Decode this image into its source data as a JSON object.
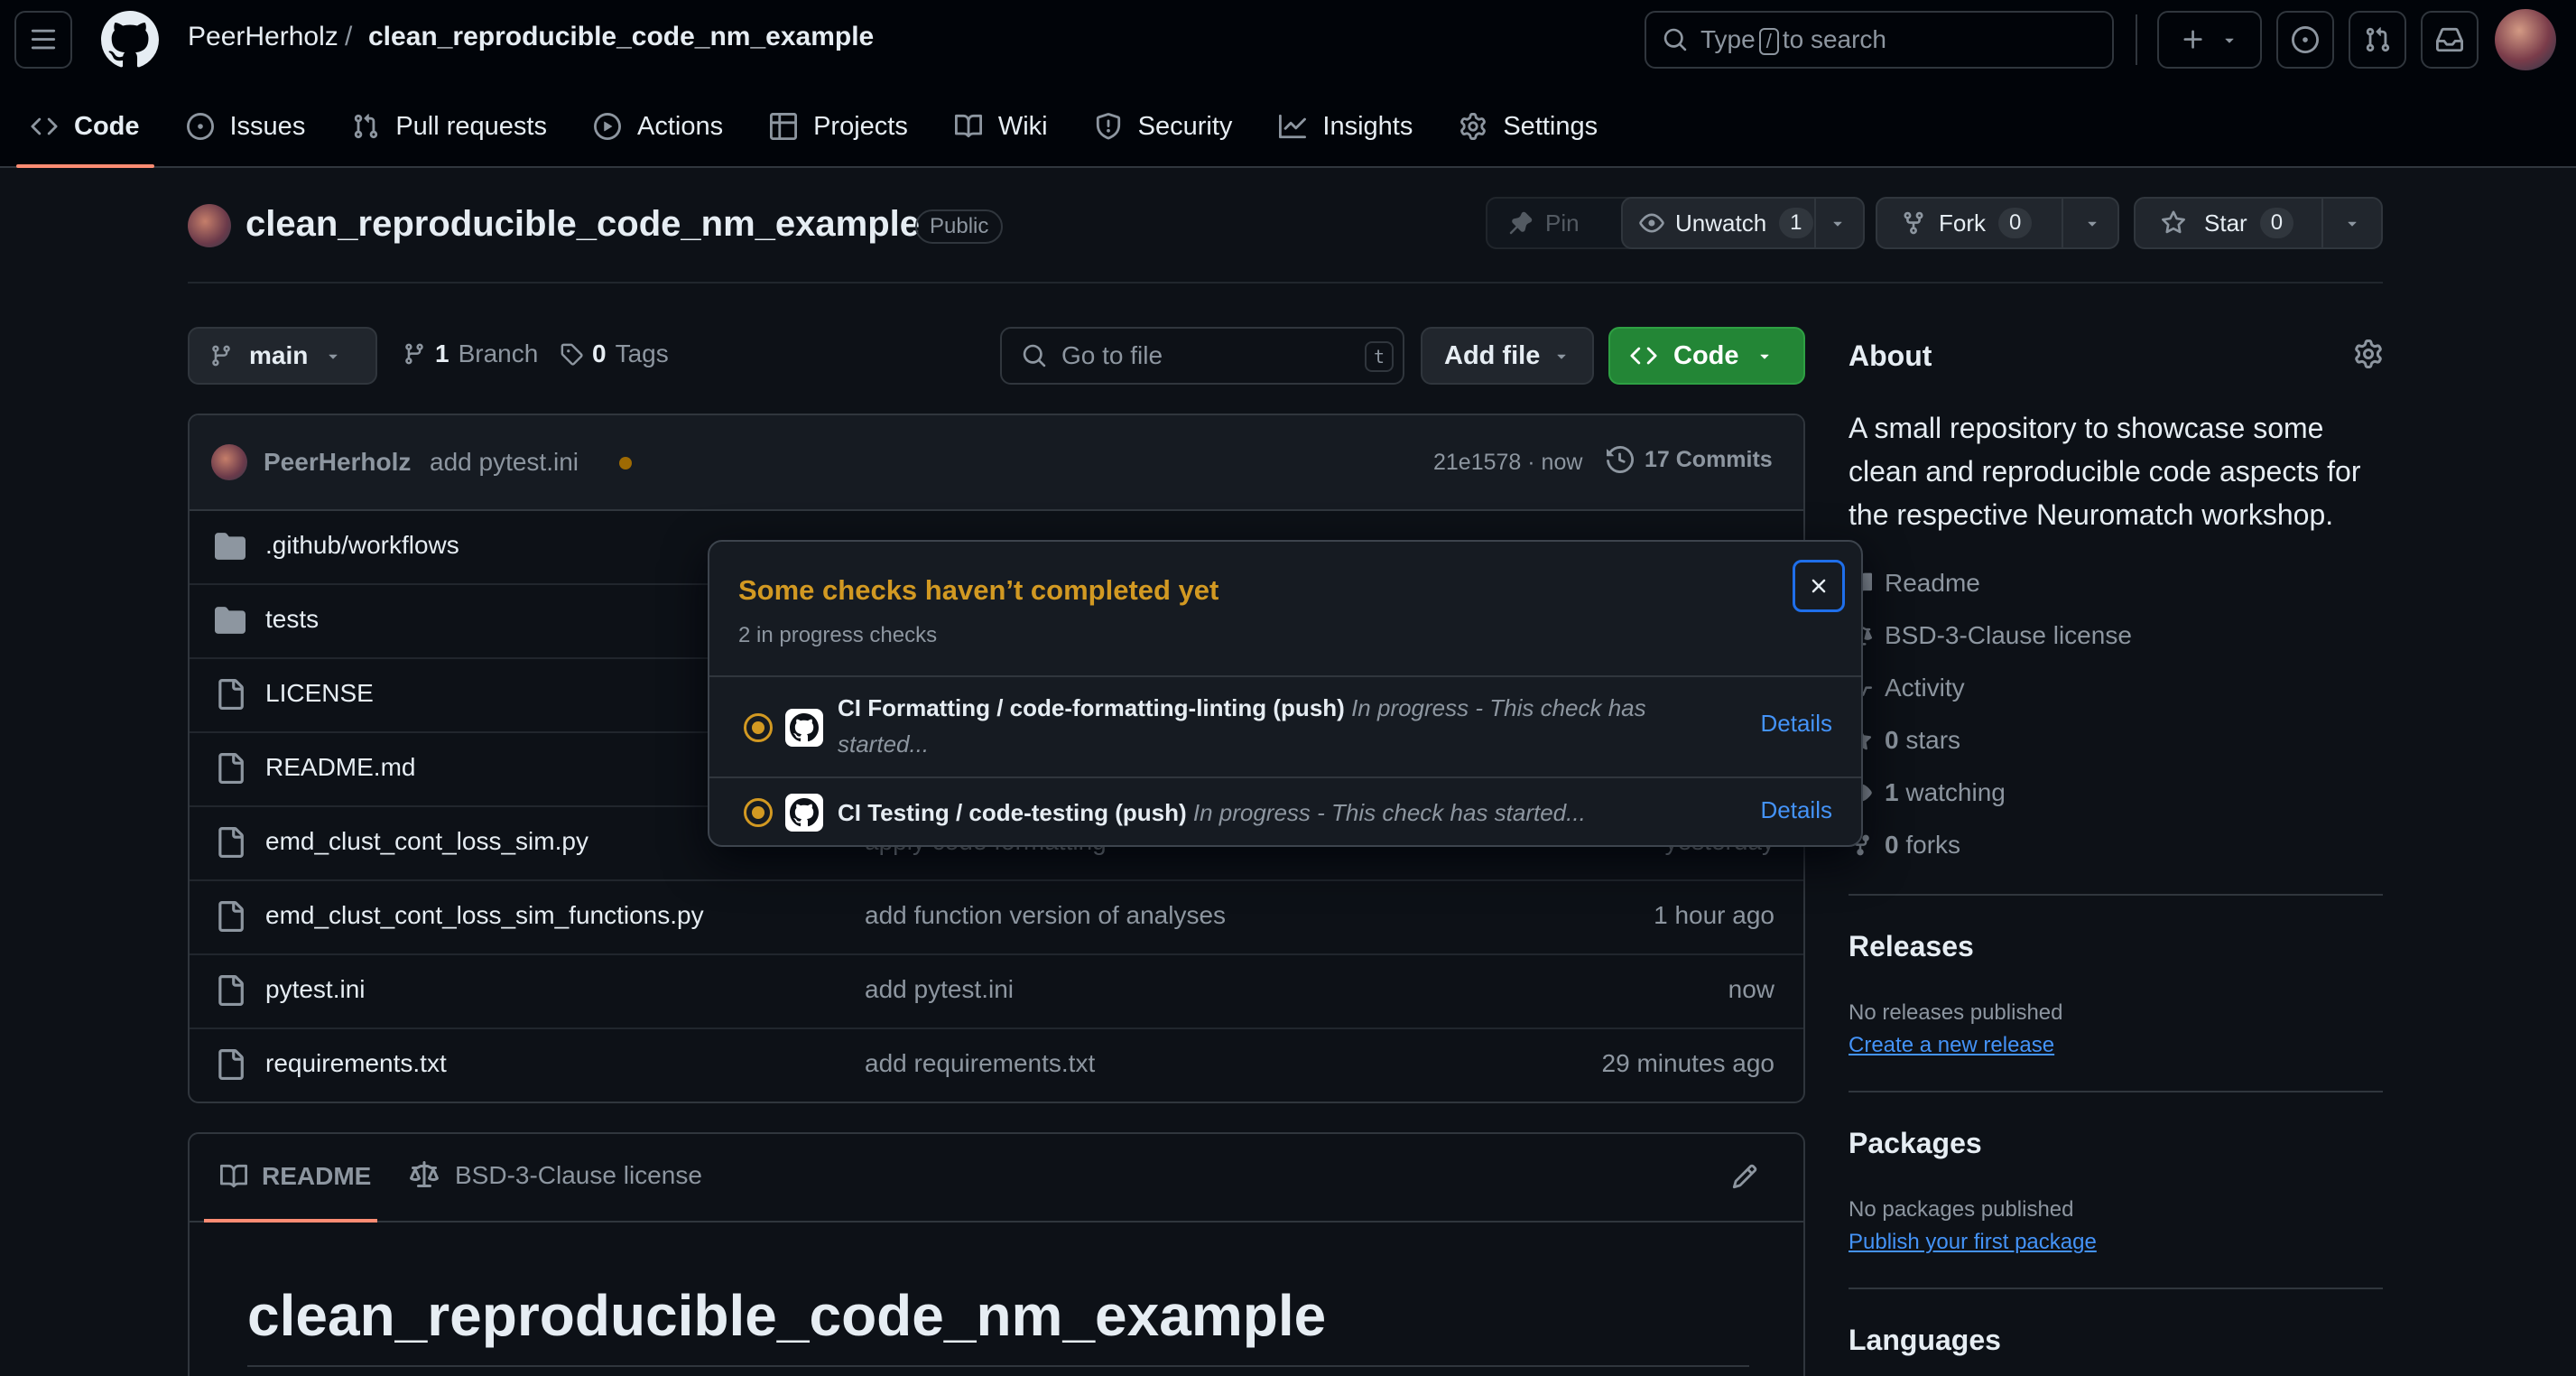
{
  "header": {
    "owner": "PeerHerholz",
    "separator": "/",
    "repo": "clean_reproducible_code_nm_example",
    "search_prefix": "Type",
    "search_key": "/",
    "search_suffix": "to search"
  },
  "nav": {
    "tabs": [
      {
        "label": "Code",
        "icon": "code-icon"
      },
      {
        "label": "Issues",
        "icon": "issue-icon"
      },
      {
        "label": "Pull requests",
        "icon": "pull-request-icon"
      },
      {
        "label": "Actions",
        "icon": "play-icon"
      },
      {
        "label": "Projects",
        "icon": "table-icon"
      },
      {
        "label": "Wiki",
        "icon": "book-icon"
      },
      {
        "label": "Security",
        "icon": "shield-icon"
      },
      {
        "label": "Insights",
        "icon": "graph-icon"
      },
      {
        "label": "Settings",
        "icon": "gear-icon"
      }
    ]
  },
  "repo": {
    "title": "clean_reproducible_code_nm_example",
    "visibility": "Public",
    "pin": "Pin",
    "unwatch": "Unwatch",
    "watch_count": "1",
    "fork": "Fork",
    "fork_count": "0",
    "star": "Star",
    "star_count": "0"
  },
  "toolbar": {
    "branch": "main",
    "branches_count": "1",
    "branches_label": "Branch",
    "tags_count": "0",
    "tags_label": "Tags",
    "goto_placeholder": "Go to file",
    "goto_key": "t",
    "add_file": "Add file",
    "code": "Code"
  },
  "commit": {
    "author": "PeerHerholz",
    "message": "add pytest.ini",
    "sha_time": "21e1578 · now",
    "commits": "17 Commits"
  },
  "files": [
    {
      "name": ".github/workflows",
      "type": "dir",
      "message": "",
      "date": ""
    },
    {
      "name": "tests",
      "type": "dir",
      "message": "",
      "date": ""
    },
    {
      "name": "LICENSE",
      "type": "file",
      "message": "",
      "date": ""
    },
    {
      "name": "README.md",
      "type": "file",
      "message": "",
      "date": ""
    },
    {
      "name": "emd_clust_cont_loss_sim.py",
      "type": "file",
      "message": "apply code formatting",
      "date": "yesterday"
    },
    {
      "name": "emd_clust_cont_loss_sim_functions.py",
      "type": "file",
      "message": "add function version of analyses",
      "date": "1 hour ago"
    },
    {
      "name": "pytest.ini",
      "type": "file",
      "message": "add pytest.ini",
      "date": "now"
    },
    {
      "name": "requirements.txt",
      "type": "file",
      "message": "add requirements.txt",
      "date": "29 minutes ago"
    }
  ],
  "readme": {
    "tab_readme": "README",
    "tab_license": "BSD-3-Clause license",
    "heading": "clean_reproducible_code_nm_example"
  },
  "sidebar": {
    "about": "About",
    "description": "A small repository to showcase some clean and reproducible code aspects for the respective Neuromatch workshop.",
    "readme": "Readme",
    "license": "BSD-3-Clause license",
    "activity": "Activity",
    "stars_count": "0",
    "stars_label": "stars",
    "watching_count": "1",
    "watching_label": "watching",
    "forks_count": "0",
    "forks_label": "forks",
    "releases": "Releases",
    "no_releases": "No releases published",
    "create_release": "Create a new release",
    "packages": "Packages",
    "no_packages": "No packages published",
    "publish_package": "Publish your first package",
    "languages": "Languages"
  },
  "popover": {
    "title": "Some checks haven’t completed yet",
    "subtitle": "2 in progress checks",
    "checks": [
      {
        "name": "CI Formatting / code-formatting-linting (push)",
        "status": "In progress - This check has started...",
        "details": "Details"
      },
      {
        "name": "CI Testing / code-testing (push)",
        "status": "In progress - This check has started...",
        "details": "Details"
      }
    ]
  },
  "colors": {
    "background": "#0d1117",
    "header": "#010409",
    "accent_orange": "#fd8c73",
    "pending_yellow": "#d29922",
    "link_blue": "#4493f8",
    "code_green": "#238636"
  }
}
